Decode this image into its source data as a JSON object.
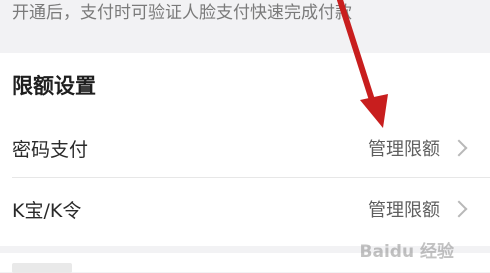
{
  "top_note": {
    "text": "开通后，支付时可验证人脸支付快速完成付款"
  },
  "limit_settings": {
    "title": "限额设置",
    "rows": [
      {
        "label": "密码支付",
        "action": "管理限额"
      },
      {
        "label": "K宝/K令",
        "action": "管理限额"
      }
    ]
  },
  "watermark": {
    "text": "Baidu 经验"
  },
  "colors": {
    "background": "#f2f2f4",
    "card": "#ffffff",
    "arrow": "#c81e1e"
  }
}
